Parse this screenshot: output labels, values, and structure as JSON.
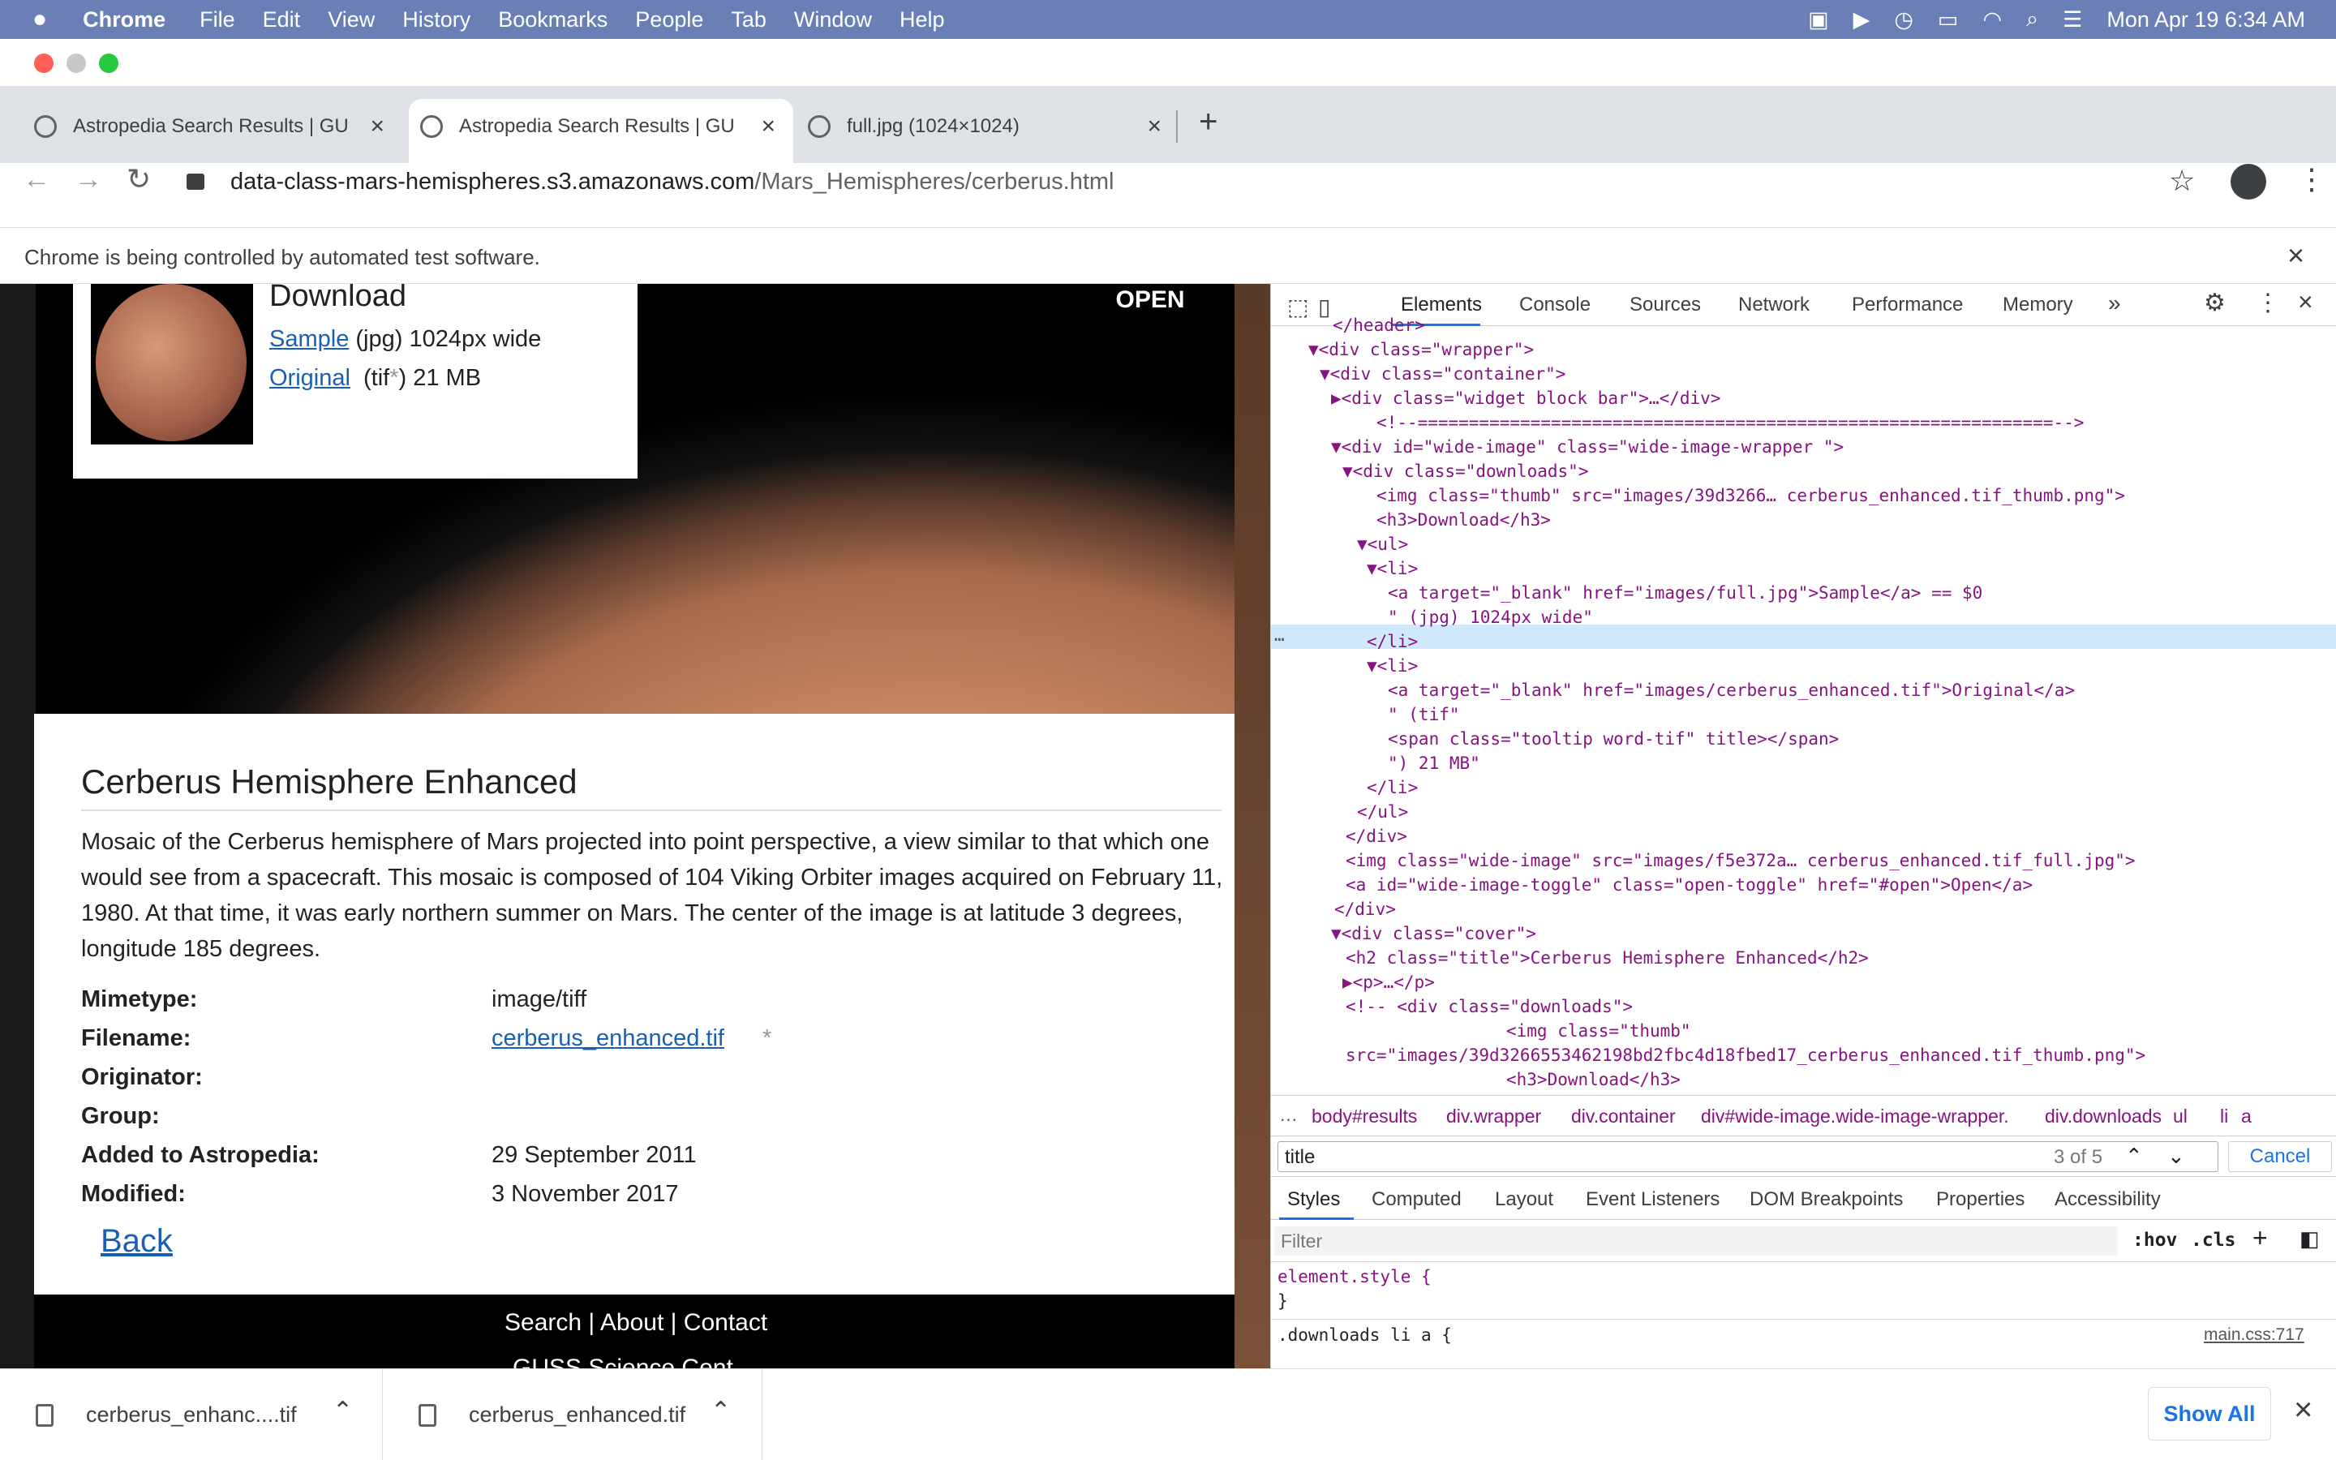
{
  "menubar": {
    "app": "Chrome",
    "items": [
      "File",
      "Edit",
      "View",
      "History",
      "Bookmarks",
      "People",
      "Tab",
      "Window",
      "Help"
    ],
    "datetime": "Mon Apr 19  6:34 AM"
  },
  "tabs": [
    {
      "title": "Astropedia Search Results | GU",
      "active": false
    },
    {
      "title": "Astropedia Search Results | GU",
      "active": true
    },
    {
      "title": "full.jpg (1024×1024)",
      "active": false
    }
  ],
  "address": {
    "host": "data-class-mars-hemispheres.s3.amazonaws.com",
    "path": "/Mars_Hemispheres/cerberus.html"
  },
  "infobar": {
    "message": "Chrome is being controlled by automated test software."
  },
  "page": {
    "open_toggle": "OPEN",
    "downloads": {
      "heading": "Download",
      "sample_link": "Sample",
      "sample_desc": "(jpg) 1024px wide",
      "original_link": "Original",
      "original_desc_a": "(tif",
      "original_desc_b": ") 21 MB",
      "tooltip_mark": "*"
    },
    "title": "Cerberus Hemisphere Enhanced",
    "description": "Mosaic of the Cerberus hemisphere of Mars projected into point perspective, a view similar to that which one would see from a spacecraft. This mosaic is composed of 104 Viking Orbiter images acquired on February 11, 1980. At that time, it was early northern summer on Mars. The center of the image is at latitude 3 degrees, longitude 185 degrees.",
    "meta": [
      {
        "label": "Mimetype:",
        "value": "image/tiff",
        "link": false
      },
      {
        "label": "Filename:",
        "value": "cerberus_enhanced.tif",
        "link": true
      },
      {
        "label": "Originator:",
        "value": "",
        "link": false
      },
      {
        "label": "Group:",
        "value": "",
        "link": false
      },
      {
        "label": "Added to Astropedia:",
        "value": "29 September 2011",
        "link": false
      },
      {
        "label": "Modified:",
        "value": "3 November 2017",
        "link": false
      }
    ],
    "back_link": "Back",
    "footer": {
      "search": "Search",
      "about": "About",
      "contact": "Contact",
      "sep": "|",
      "partial": "GUSS Science Cent"
    }
  },
  "devtools": {
    "tabs": [
      "Elements",
      "Console",
      "Sources",
      "Network",
      "Performance",
      "Memory"
    ],
    "more": "»",
    "dom_lines": [
      "</header>",
      "▼<div class=\"wrapper\">",
      "▼<div class=\"container\">",
      "▶<div class=\"widget block bar\">…</div>",
      "<!--==============================================================-->",
      "▼<div id=\"wide-image\" class=\"wide-image-wrapper \">",
      "▼<div class=\"downloads\">",
      "<img class=\"thumb\" src=\"images/39d3266… cerberus_enhanced.tif_thumb.png\">",
      "<h3>Download</h3>",
      "▼<ul>",
      "▼<li>",
      "<a target=\"_blank\" href=\"images/full.jpg\">Sample</a> == $0",
      "\" (jpg) 1024px wide\"",
      "</li>",
      "▼<li>",
      "<a target=\"_blank\" href=\"images/cerberus_enhanced.tif\">Original</a>",
      "\" (tif\"",
      "<span class=\"tooltip word-tif\" title></span>",
      "\") 21 MB\"",
      "</li>",
      "</ul>",
      "</div>",
      "<img class=\"wide-image\" src=\"images/f5e372a… cerberus_enhanced.tif_full.jpg\">",
      "<a id=\"wide-image-toggle\" class=\"open-toggle\" href=\"#open\">Open</a>",
      "</div>",
      "▼<div class=\"cover\">",
      "<h2 class=\"title\">Cerberus Hemisphere Enhanced</h2>",
      "▶<p>…</p>",
      "<!-- <div class=\"downloads\">",
      "<img class=\"thumb\"",
      "src=\"images/39d3266553462198bd2fbc4d18fbed17_cerberus_enhanced.tif_thumb.png\">",
      "<h3>Download</h3>"
    ],
    "row_dots": "…",
    "breadcrumbs": [
      "body#results",
      "div.wrapper",
      "div.container",
      "div#wide-image.wide-image-wrapper.",
      "div.downloads",
      "ul",
      "li",
      "a"
    ],
    "search_query": "title",
    "search_count": "3 of 5",
    "search_cancel": "Cancel",
    "style_tabs": [
      "Styles",
      "Computed",
      "Layout",
      "Event Listeners",
      "DOM Breakpoints",
      "Properties",
      "Accessibility"
    ],
    "filter_placeholder": "Filter",
    "hov": ":hov",
    "cls": ".cls",
    "element_style": "element.style {",
    "rule_close": "}",
    "rule_selector": ".downloads li a {",
    "rule_source": "main.css:717"
  },
  "downloads_shelf": {
    "items": [
      "cerberus_enhanc....tif",
      "cerberus_enhanced.tif"
    ],
    "show_all": "Show All"
  }
}
